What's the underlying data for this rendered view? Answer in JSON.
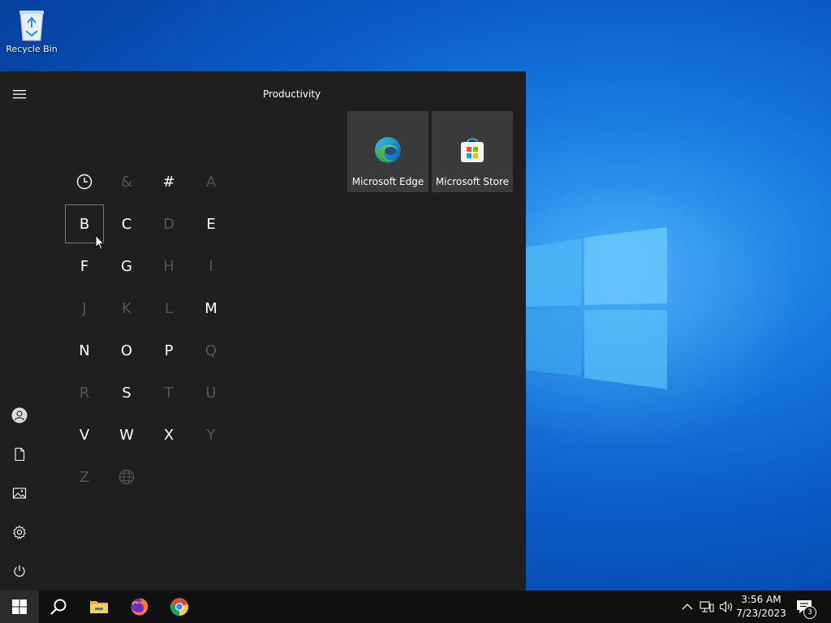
{
  "desktop": {
    "icons": [
      {
        "label": "Recycle Bin",
        "icon": "recycle-bin-icon"
      }
    ]
  },
  "start_menu": {
    "rail": {
      "items": [
        {
          "icon": "hamburger-menu-icon"
        },
        {
          "icon": "user-account-icon"
        },
        {
          "icon": "documents-icon"
        },
        {
          "icon": "pictures-icon"
        },
        {
          "icon": "settings-gear-icon"
        },
        {
          "icon": "power-icon"
        }
      ]
    },
    "alphabet_index": [
      {
        "label": "clock",
        "enabled": true,
        "is_icon": true
      },
      {
        "label": "&",
        "enabled": false
      },
      {
        "label": "#",
        "enabled": true
      },
      {
        "label": "A",
        "enabled": false
      },
      {
        "label": "B",
        "enabled": true,
        "focused": true
      },
      {
        "label": "C",
        "enabled": true
      },
      {
        "label": "D",
        "enabled": false
      },
      {
        "label": "E",
        "enabled": true
      },
      {
        "label": "F",
        "enabled": true
      },
      {
        "label": "G",
        "enabled": true
      },
      {
        "label": "H",
        "enabled": false
      },
      {
        "label": "I",
        "enabled": false
      },
      {
        "label": "J",
        "enabled": false
      },
      {
        "label": "K",
        "enabled": false
      },
      {
        "label": "L",
        "enabled": false
      },
      {
        "label": "M",
        "enabled": true
      },
      {
        "label": "N",
        "enabled": true
      },
      {
        "label": "O",
        "enabled": true
      },
      {
        "label": "P",
        "enabled": true
      },
      {
        "label": "Q",
        "enabled": false
      },
      {
        "label": "R",
        "enabled": false
      },
      {
        "label": "S",
        "enabled": true
      },
      {
        "label": "T",
        "enabled": false
      },
      {
        "label": "U",
        "enabled": false
      },
      {
        "label": "V",
        "enabled": true
      },
      {
        "label": "W",
        "enabled": true
      },
      {
        "label": "X",
        "enabled": true
      },
      {
        "label": "Y",
        "enabled": false
      },
      {
        "label": "Z",
        "enabled": false
      },
      {
        "label": "globe",
        "enabled": false,
        "is_icon": true
      }
    ],
    "tiles_group": {
      "title": "Productivity",
      "tiles": [
        {
          "label": "Microsoft Edge",
          "icon": "edge-icon"
        },
        {
          "label": "Microsoft Store",
          "icon": "store-icon"
        }
      ]
    }
  },
  "taskbar": {
    "pinned": [
      {
        "icon": "windows-start-icon"
      },
      {
        "icon": "search-icon"
      },
      {
        "icon": "file-explorer-icon"
      },
      {
        "icon": "firefox-icon"
      },
      {
        "icon": "chrome-icon"
      }
    ],
    "tray": {
      "time": "3:56 AM",
      "date": "7/23/2023",
      "notification_count": "3"
    }
  },
  "colors": {
    "start_bg": "#1f1f1f",
    "tile_bg": "#3a3a3a",
    "taskbar_bg": "#101010",
    "disabled_letter": "#555555"
  }
}
